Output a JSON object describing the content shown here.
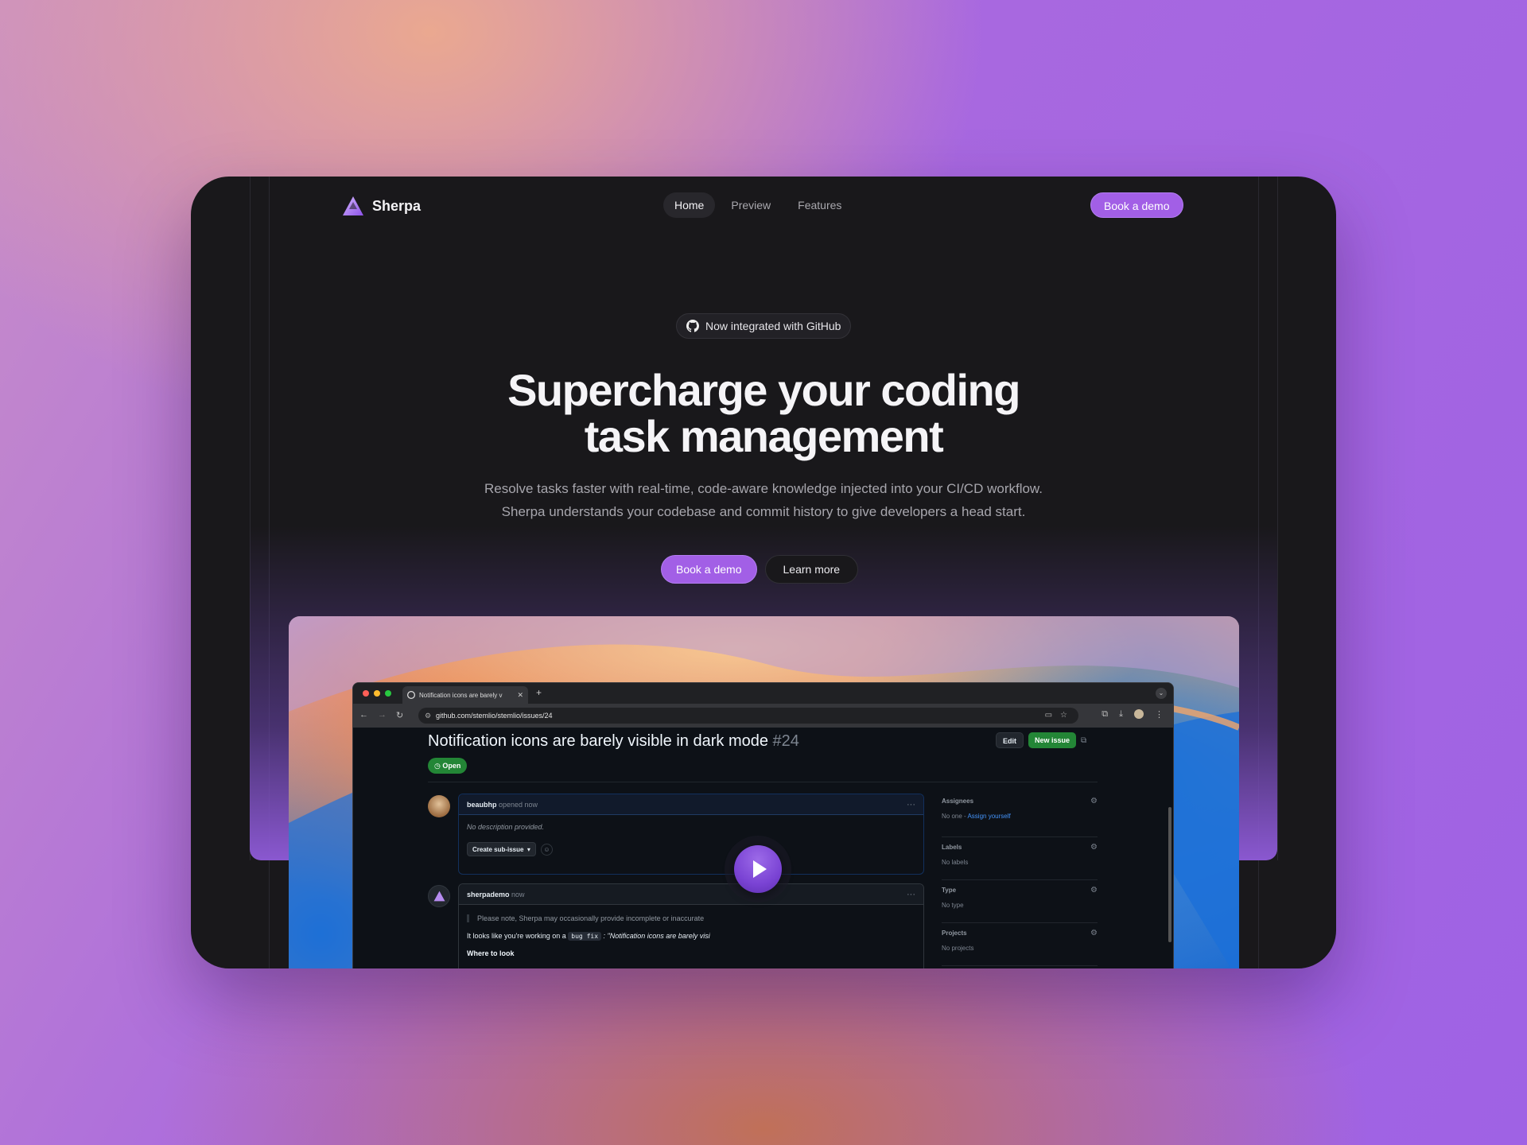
{
  "brand": {
    "name": "Sherpa",
    "accent": "#a25fe6"
  },
  "nav": {
    "links": [
      {
        "label": "Home",
        "active": true
      },
      {
        "label": "Preview",
        "active": false
      },
      {
        "label": "Features",
        "active": false
      }
    ],
    "cta": "Book a demo"
  },
  "hero": {
    "badge": "Now integrated with GitHub",
    "title_line1": "Supercharge your coding",
    "title_line2": "task management",
    "subtitle_line1": "Resolve tasks faster with real-time, code-aware knowledge injected into your CI/CD workflow.",
    "subtitle_line2": "Sherpa understands your codebase and commit history to give developers a head start.",
    "primary_cta": "Book a demo",
    "secondary_cta": "Learn more"
  },
  "browser": {
    "tab_title": "Notification icons are barely v",
    "url": "github.com/stemlio/stemlio/issues/24"
  },
  "issue": {
    "title": "Notification icons are barely visible in dark mode",
    "number": "#24",
    "status": "Open",
    "edit_label": "Edit",
    "new_issue_label": "New issue",
    "comment1": {
      "user": "beaubhp",
      "meta": "opened now",
      "body": "No description provided.",
      "subissue_label": "Create sub-issue"
    },
    "comment2": {
      "user": "sherpademo",
      "meta": "now",
      "note": "Please note, Sherpa may occasionally provide incomplete or inaccurate",
      "line_prefix": "It looks like you're working on a",
      "code": "bug fix",
      "line_suffix": ": \"Notification icons are barely visi",
      "heading": "Where to look"
    },
    "sidebar": [
      {
        "label": "Assignees",
        "value": "No one - ",
        "link": "Assign yourself"
      },
      {
        "label": "Labels",
        "value": "No labels",
        "link": ""
      },
      {
        "label": "Type",
        "value": "No type",
        "link": ""
      },
      {
        "label": "Projects",
        "value": "No projects",
        "link": ""
      }
    ]
  },
  "icons": [
    "sherpa-logo-icon",
    "github-icon",
    "play-icon",
    "gear-icon",
    "back-arrow-icon",
    "forward-arrow-icon",
    "reload-icon"
  ]
}
